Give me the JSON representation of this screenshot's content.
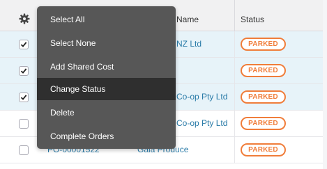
{
  "header": {
    "supplier_label": "Name",
    "status_label": "Status",
    "settings_icon": "gear-icon"
  },
  "rows": [
    {
      "checked": true,
      "po": "",
      "supplier": "NZ Ltd",
      "status": "PARKED"
    },
    {
      "checked": true,
      "po": "",
      "supplier": "",
      "status": "PARKED"
    },
    {
      "checked": true,
      "po": "",
      "supplier": "Co-op Pty Ltd",
      "status": "PARKED"
    },
    {
      "checked": false,
      "po": "",
      "supplier": "Co-op Pty Ltd",
      "status": "PARKED"
    },
    {
      "checked": false,
      "po": "PO-00001522",
      "supplier": "Gala Produce",
      "status": "PARKED"
    }
  ],
  "menu": {
    "items": [
      "Select All",
      "Select None",
      "Add Shared Cost",
      "Change Status",
      "Delete",
      "Complete Orders"
    ],
    "highlighted_index": 3
  },
  "colors": {
    "link": "#2a7ba8",
    "status_parked": "#f07d3a",
    "selected_row": "#e7f3f9",
    "menu_bg": "#575757",
    "menu_active": "#2f2f2f"
  }
}
